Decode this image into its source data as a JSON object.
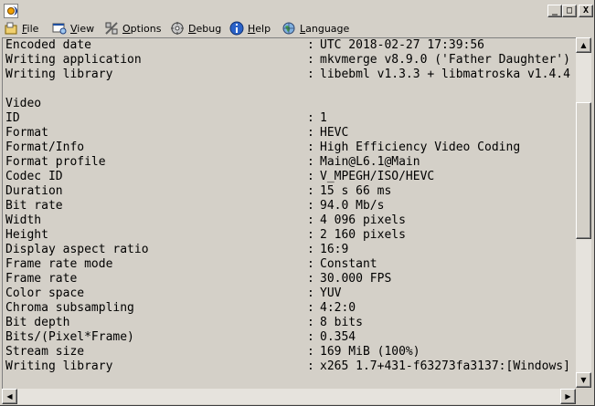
{
  "window": {
    "controls": {
      "minimize": "_",
      "maximize": "□",
      "close": "X"
    }
  },
  "menu": [
    {
      "label": "File",
      "icon": "file-icon"
    },
    {
      "label": "View",
      "icon": "view-icon"
    },
    {
      "label": "Options",
      "icon": "options-icon"
    },
    {
      "label": "Debug",
      "icon": "debug-icon"
    },
    {
      "label": "Help",
      "icon": "help-icon"
    },
    {
      "label": "Language",
      "icon": "language-icon"
    }
  ],
  "lines": [
    {
      "key": "Encoded date",
      "value": "UTC 2018-02-27 17:39:56"
    },
    {
      "key": "Writing application",
      "value": "mkvmerge v8.9.0 ('Father Daughter')"
    },
    {
      "key": "Writing library",
      "value": "libebml v1.3.3 + libmatroska v1.4.4"
    },
    {
      "key": "",
      "value": ""
    },
    {
      "key": "Video",
      "value": ""
    },
    {
      "key": "ID",
      "value": "1"
    },
    {
      "key": "Format",
      "value": "HEVC"
    },
    {
      "key": "Format/Info",
      "value": "High Efficiency Video Coding"
    },
    {
      "key": "Format profile",
      "value": "Main@L6.1@Main"
    },
    {
      "key": "Codec ID",
      "value": "V_MPEGH/ISO/HEVC"
    },
    {
      "key": "Duration",
      "value": "15 s 66 ms"
    },
    {
      "key": "Bit rate",
      "value": "94.0 Mb/s"
    },
    {
      "key": "Width",
      "value": "4 096 pixels"
    },
    {
      "key": "Height",
      "value": "2 160 pixels"
    },
    {
      "key": "Display aspect ratio",
      "value": "16:9"
    },
    {
      "key": "Frame rate mode",
      "value": "Constant"
    },
    {
      "key": "Frame rate",
      "value": "30.000 FPS"
    },
    {
      "key": "Color space",
      "value": "YUV"
    },
    {
      "key": "Chroma subsampling",
      "value": "4:2:0"
    },
    {
      "key": "Bit depth",
      "value": "8 bits"
    },
    {
      "key": "Bits/(Pixel*Frame)",
      "value": "0.354"
    },
    {
      "key": "Stream size",
      "value": "169 MiB (100%)"
    },
    {
      "key": "Writing library",
      "value": "x265 1.7+431-f63273fa3137:[Windows]"
    }
  ],
  "scrollbars": {
    "up_arrow": "▲",
    "down_arrow": "▼",
    "left_arrow": "◀",
    "right_arrow": "▶"
  }
}
